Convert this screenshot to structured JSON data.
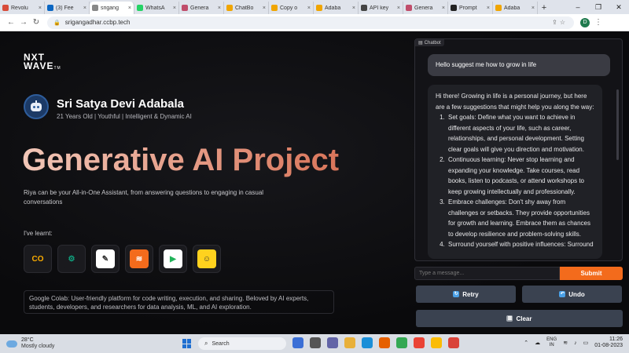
{
  "browser": {
    "tabs": [
      {
        "title": "Revolu",
        "color": "#d84c3a",
        "active": false
      },
      {
        "title": "(3) Fee",
        "color": "#0a66c2",
        "active": false
      },
      {
        "title": "srigang",
        "color": "#888888",
        "active": true
      },
      {
        "title": "WhatsA",
        "color": "#25d366",
        "active": false
      },
      {
        "title": "Genera",
        "color": "#c04d6b",
        "active": false
      },
      {
        "title": "ChatBo",
        "color": "#f0a500",
        "active": false
      },
      {
        "title": "Copy o",
        "color": "#f0a500",
        "active": false
      },
      {
        "title": "Adaba",
        "color": "#f0a500",
        "active": false
      },
      {
        "title": "API key",
        "color": "#444444",
        "active": false
      },
      {
        "title": "Genera",
        "color": "#c04d6b",
        "active": false
      },
      {
        "title": "Prompt",
        "color": "#222222",
        "active": false
      },
      {
        "title": "Adaba",
        "color": "#f0a500",
        "active": false
      }
    ],
    "new_tab": "+",
    "url": "srigangadhar.ccbp.tech",
    "profile_initial": "D"
  },
  "left": {
    "logo_line1": "NXT",
    "logo_line2": "WAVE",
    "logo_tm": "TM",
    "profile_name": "Sri Satya Devi Adabala",
    "profile_sub": "21 Years Old | Youthful | Intelligent & Dynamic AI",
    "hero_title": "Generative AI Project",
    "description": "Riya can be your All-in-One Assistant, from answering questions to engaging in casual conversations",
    "learnt_label": "I've learnt:",
    "tools": [
      {
        "name": "colab",
        "label": "CO",
        "bg": "#1a1a1e",
        "fg": "#f9ab00"
      },
      {
        "name": "openai",
        "label": "⚙",
        "bg": "#1a1a1e",
        "fg": "#10a37f"
      },
      {
        "name": "ai21",
        "label": "✎",
        "bg": "#ffffff",
        "fg": "#333333"
      },
      {
        "name": "layers",
        "label": "≋",
        "bg": "#f36b1c",
        "fg": "#ffffff"
      },
      {
        "name": "play",
        "label": "▶",
        "bg": "#ffffff",
        "fg": "#21b35a"
      },
      {
        "name": "huggingface",
        "label": "☺",
        "bg": "#ffd21e",
        "fg": "#333333"
      }
    ],
    "info_text": "Google Colab: User-friendly platform for code writing, execution, and sharing. Beloved by AI experts, students, developers, and researchers for data analysis, ML, and AI exploration."
  },
  "chat": {
    "label": "Chatbot",
    "user_message": "Hello suggest me how to grow in life",
    "bot_intro": "Hi there! Growing in life is a personal journey, but here are a few suggestions that might help you along the way:",
    "bot_points": [
      "Set goals: Define what you want to achieve in different aspects of your life, such as career, relationships, and personal development. Setting clear goals will give you direction and motivation.",
      "Continuous learning: Never stop learning and expanding your knowledge. Take courses, read books, listen to podcasts, or attend workshops to keep growing intellectually and professionally.",
      "Embrace challenges: Don't shy away from challenges or setbacks. They provide opportunities for growth and learning. Embrace them as chances to develop resilience and problem-solving skills.",
      "Surround yourself with positive influences: Surround"
    ],
    "input_placeholder": "Type a message...",
    "submit_label": "Submit",
    "retry_label": "Retry",
    "undo_label": "Undo",
    "clear_label": "Clear"
  },
  "taskbar": {
    "temp": "28°C",
    "weather": "Mostly cloudy",
    "search": "Search",
    "lang1": "ENG",
    "lang2": "IN",
    "time": "11:26",
    "date": "01-08-2023"
  }
}
